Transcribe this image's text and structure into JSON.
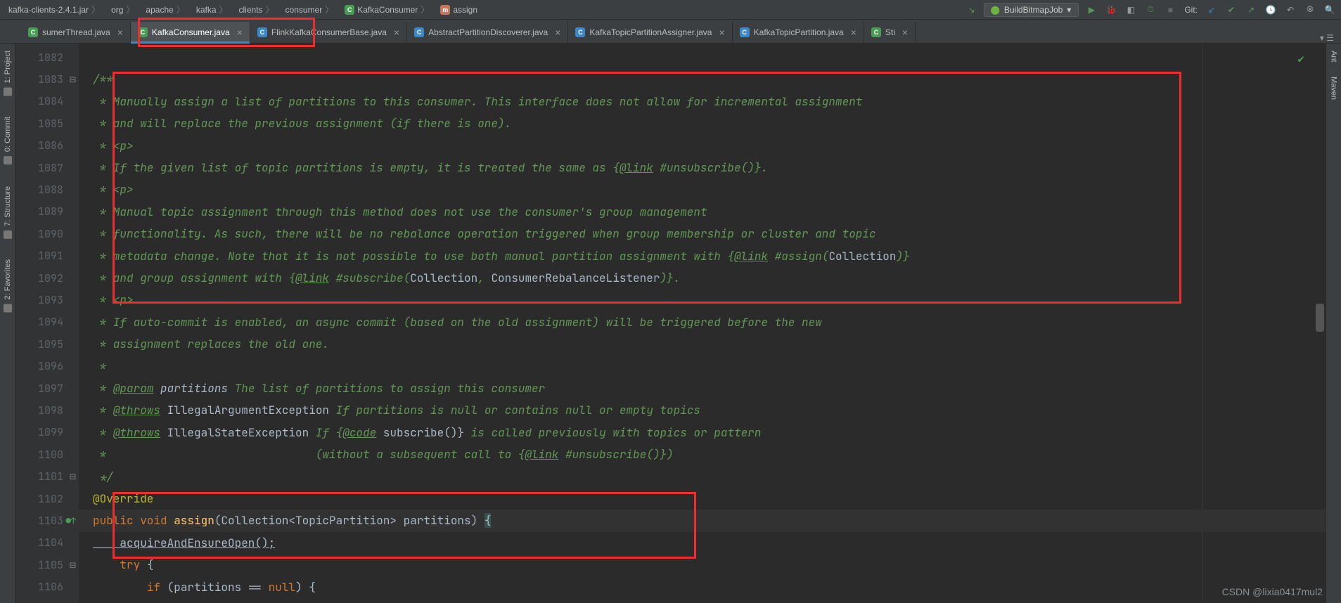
{
  "breadcrumb": {
    "jar": "kafka-clients-2.4.1.jar",
    "p1": "org",
    "p2": "apache",
    "p3": "kafka",
    "p4": "clients",
    "p5": "consumer",
    "cls": "KafkaConsumer",
    "method": "assign"
  },
  "runConfig": "BuildBitmapJob",
  "gitLabel": "Git:",
  "tabs": [
    {
      "label": "sumerThread.java",
      "icon": "c"
    },
    {
      "label": "KafkaConsumer.java",
      "icon": "c",
      "active": true
    },
    {
      "label": "FlinkKafkaConsumerBase.java",
      "icon": "f"
    },
    {
      "label": "AbstractPartitionDiscoverer.java",
      "icon": "f"
    },
    {
      "label": "KafkaTopicPartitionAssigner.java",
      "icon": "f"
    },
    {
      "label": "KafkaTopicPartition.java",
      "icon": "f"
    },
    {
      "label": "Sti",
      "icon": "c"
    }
  ],
  "leftTools": [
    {
      "l": "1: Project"
    },
    {
      "l": "0: Commit"
    },
    {
      "l": "7: Structure"
    },
    {
      "l": "2: Favorites"
    }
  ],
  "rightTools": [
    {
      "l": "Ant"
    },
    {
      "l": "Maven"
    }
  ],
  "gutterStart": 1082,
  "code_lines": [
    {
      "t": ""
    },
    {
      "t": "/**",
      "cls": "c-comment",
      "mark": "⊟"
    },
    {
      "t": " * Manually assign a list of partitions to this consumer. This interface does not allow for incremental assignment",
      "cls": "c-comment"
    },
    {
      "t": " * and will replace the previous assignment (if there is one).",
      "cls": "c-comment"
    },
    {
      "t": " * <p>",
      "cls": "c-comment"
    },
    {
      "segments": [
        {
          "t": " * If the given list of topic partitions is empty, it is treated the same as {",
          "c": "c-comment"
        },
        {
          "t": "@link",
          "c": "c-tag"
        },
        {
          "t": " #unsubscribe()}.",
          "c": "c-comment"
        }
      ]
    },
    {
      "t": " * <p>",
      "cls": "c-comment"
    },
    {
      "t": " * Manual topic assignment through this method does not use the consumer's group management",
      "cls": "c-comment"
    },
    {
      "t": " * functionality. As such, there will be no rebalance operation triggered when group membership or cluster and topic",
      "cls": "c-comment"
    },
    {
      "segments": [
        {
          "t": " * metadata change. Note that it is not possible to use both manual partition assignment with {",
          "c": "c-comment"
        },
        {
          "t": "@link",
          "c": "c-tag"
        },
        {
          "t": " #assign(",
          "c": "c-comment"
        },
        {
          "t": "Collection",
          "c": "c-ident"
        },
        {
          "t": ")}",
          "c": "c-comment"
        }
      ]
    },
    {
      "segments": [
        {
          "t": " * and group assignment with {",
          "c": "c-comment"
        },
        {
          "t": "@link",
          "c": "c-tag"
        },
        {
          "t": " #subscribe(",
          "c": "c-comment"
        },
        {
          "t": "Collection",
          "c": "c-ident"
        },
        {
          "t": ", ",
          "c": "c-comment"
        },
        {
          "t": "ConsumerRebalanceListener",
          "c": "c-ident"
        },
        {
          "t": ")}.",
          "c": "c-comment"
        }
      ]
    },
    {
      "t": " * <p>",
      "cls": "c-comment"
    },
    {
      "t": " * If auto-commit is enabled, an async commit (based on the old assignment) will be triggered before the new",
      "cls": "c-comment"
    },
    {
      "t": " * assignment replaces the old one.",
      "cls": "c-comment"
    },
    {
      "t": " *",
      "cls": "c-comment"
    },
    {
      "segments": [
        {
          "t": " * ",
          "c": "c-comment"
        },
        {
          "t": "@param",
          "c": "c-tag"
        },
        {
          "t": " partitions",
          "c": "c-type"
        },
        {
          "t": " The list of partitions to assign this consumer",
          "c": "c-comment"
        }
      ]
    },
    {
      "segments": [
        {
          "t": " * ",
          "c": "c-comment"
        },
        {
          "t": "@throws",
          "c": "c-tag"
        },
        {
          "t": " IllegalArgumentException",
          "c": "c-ident"
        },
        {
          "t": " If partitions is null or contains null or empty topics",
          "c": "c-comment"
        }
      ]
    },
    {
      "segments": [
        {
          "t": " * ",
          "c": "c-comment"
        },
        {
          "t": "@throws",
          "c": "c-tag"
        },
        {
          "t": " IllegalStateException",
          "c": "c-ident"
        },
        {
          "t": " If {",
          "c": "c-comment"
        },
        {
          "t": "@code",
          "c": "c-tag"
        },
        {
          "t": " subscribe()}",
          "c": "c-ident"
        },
        {
          "t": " is called previously with topics or pattern",
          "c": "c-comment"
        }
      ]
    },
    {
      "segments": [
        {
          "t": " *                               (without a subsequent call to {",
          "c": "c-comment"
        },
        {
          "t": "@link",
          "c": "c-tag"
        },
        {
          "t": " #unsubscribe()})",
          "c": "c-comment"
        }
      ]
    },
    {
      "t": " */",
      "cls": "c-comment",
      "mark": "⊟"
    },
    {
      "segments": [
        {
          "t": "@Override",
          "c": "c-anno"
        }
      ]
    },
    {
      "segments": [
        {
          "t": "public void ",
          "c": "c-keyword"
        },
        {
          "t": "assign",
          "c": "c-method"
        },
        {
          "t": "(Collection<TopicPartition> ",
          "c": "c-ident"
        },
        {
          "t": "partitions",
          "c": "c-param"
        },
        {
          "t": ") ",
          "c": "c-ident"
        },
        {
          "t": "{",
          "c": "c-caret"
        }
      ],
      "cur": true,
      "green": true
    },
    {
      "segments": [
        {
          "t": "    acquireAndEnsureOpen();",
          "c": "c-ident c-link"
        }
      ]
    },
    {
      "segments": [
        {
          "t": "    ",
          "c": ""
        },
        {
          "t": "try",
          "c": "c-keyword"
        },
        {
          "t": " {",
          "c": "c-ident"
        }
      ],
      "mark": "⊟"
    },
    {
      "segments": [
        {
          "t": "        ",
          "c": ""
        },
        {
          "t": "if",
          "c": "c-keyword"
        },
        {
          "t": " (partitions == ",
          "c": "c-ident"
        },
        {
          "t": "null",
          "c": "c-keyword"
        },
        {
          "t": ") {",
          "c": "c-ident"
        }
      ]
    }
  ],
  "watermark": "CSDN @lixia0417mul2"
}
